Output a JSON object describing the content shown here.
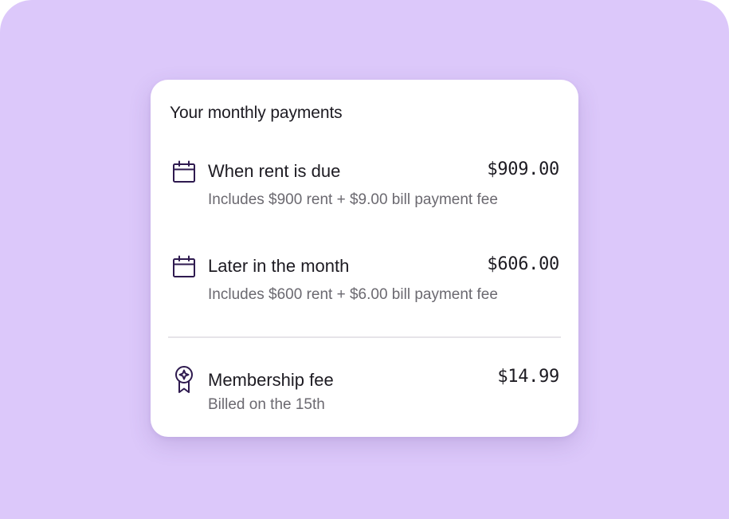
{
  "card": {
    "title": "Your monthly payments"
  },
  "payments": [
    {
      "label": "When rent is due",
      "amount": "$909.00",
      "detail": "Includes $900 rent + $9.00 bill payment fee",
      "icon": "calendar-icon"
    },
    {
      "label": "Later in the month",
      "amount": "$606.00",
      "detail": "Includes $600 rent + $6.00 bill payment fee",
      "icon": "calendar-icon"
    }
  ],
  "membership": {
    "label": "Membership fee",
    "amount": "$14.99",
    "detail": "Billed on the 15th",
    "icon": "award-ribbon-icon"
  },
  "colors": {
    "background": "#dcc8fa",
    "card": "#ffffff",
    "icon": "#2e1a4f",
    "text_primary": "#1d1b22",
    "text_secondary": "#6b6970",
    "divider": "#e6e4e9"
  }
}
